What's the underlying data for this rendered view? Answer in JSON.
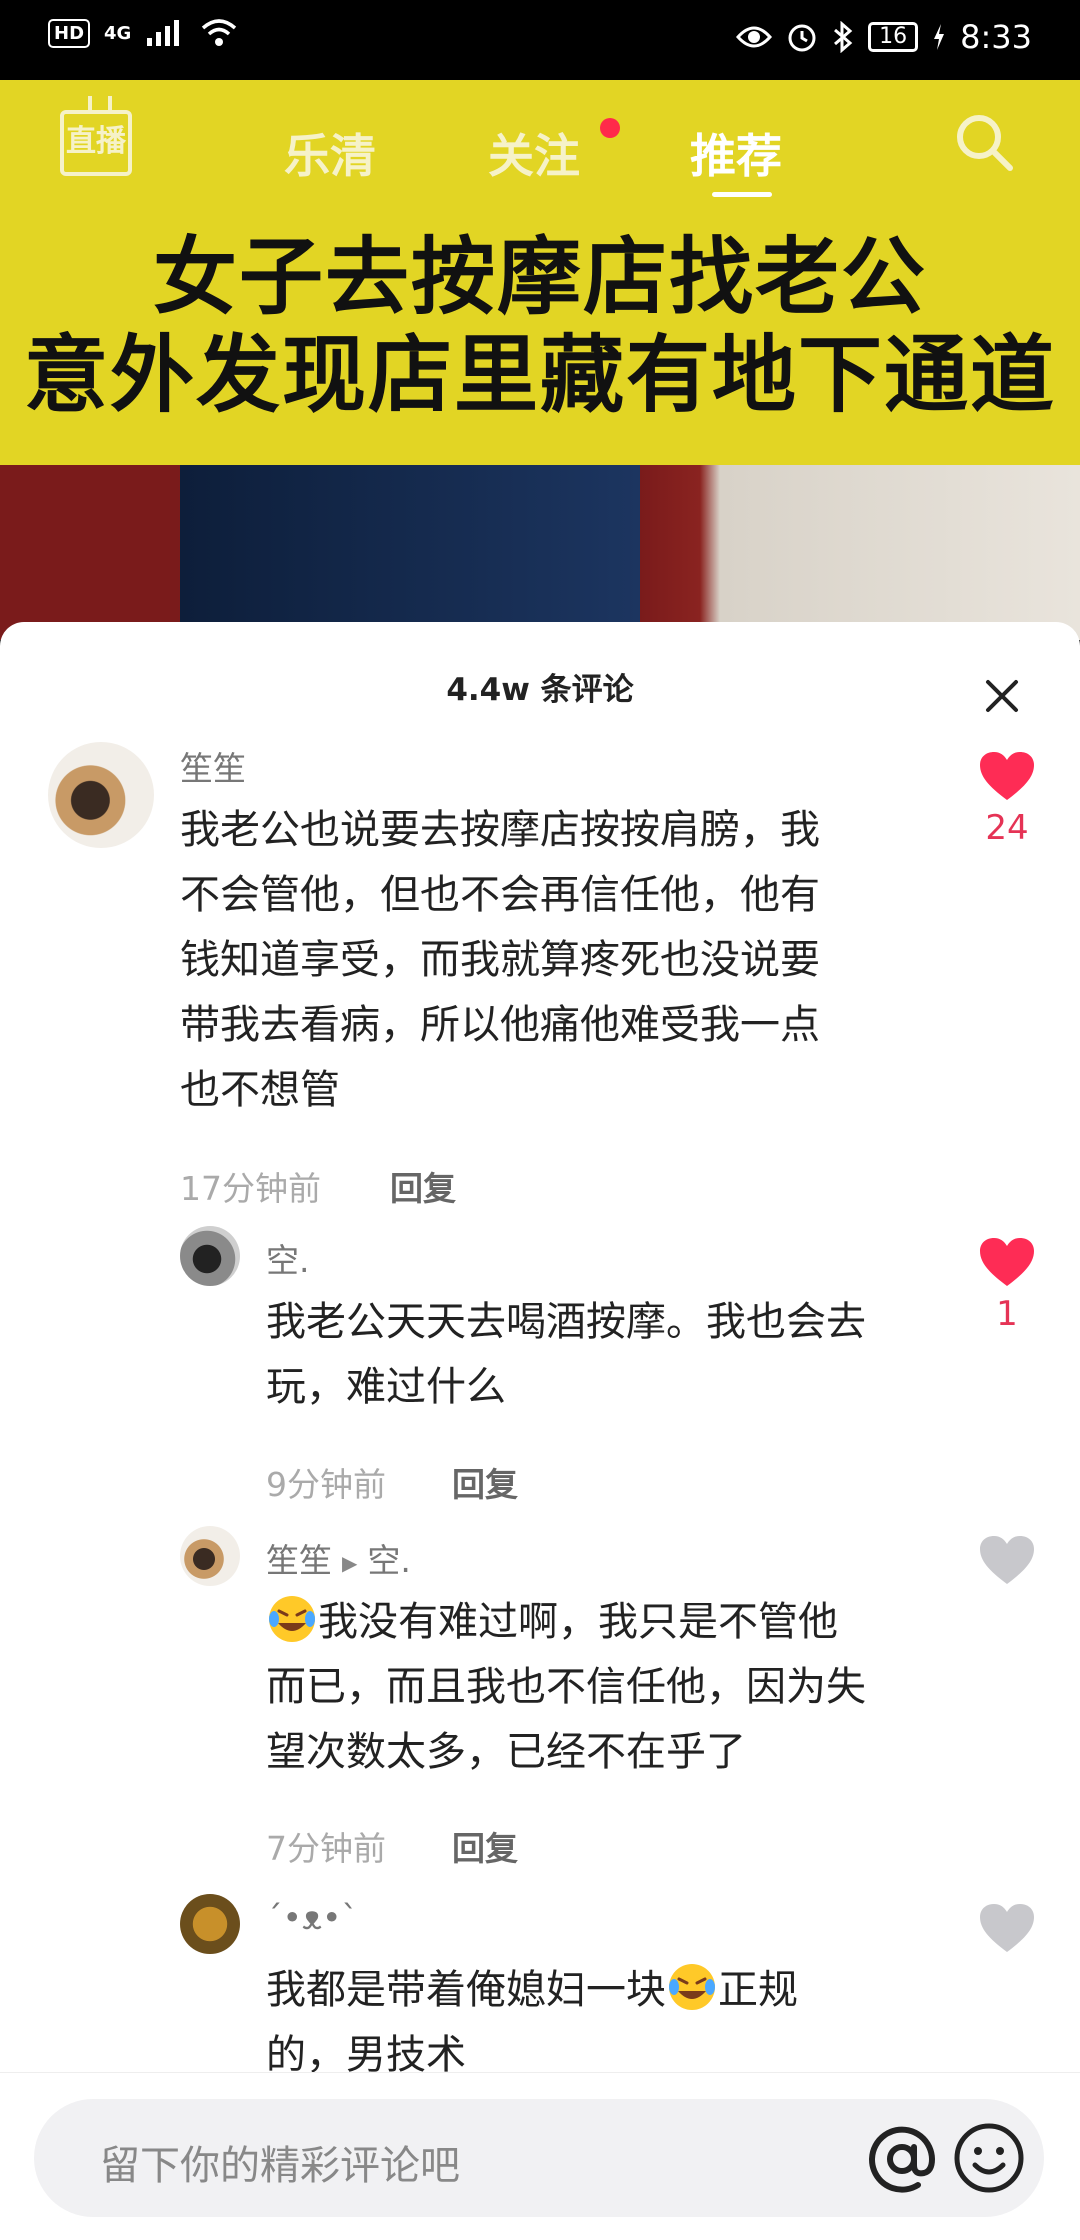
{
  "status_bar": {
    "hd": "HD",
    "network": "4G",
    "battery": "16",
    "time": "8:33"
  },
  "video": {
    "title_line1": "女子去按摩店找老公",
    "title_line2": "意外发现店里藏有地下通道",
    "banner_color": "#e2d524"
  },
  "top_nav": {
    "live_label": "直播",
    "tabs": [
      {
        "label": "乐清"
      },
      {
        "label": "关注"
      },
      {
        "label": "推荐"
      }
    ],
    "active_tab": "推荐"
  },
  "comments_sheet": {
    "title": "4.4w 条评论",
    "comments": [
      {
        "name": "笙笙",
        "lines": [
          "我老公也说要去按摩店按按肩膀，我",
          "不会管他，但也不会再信任他，他有",
          "钱知道享受，而我就算疼死也没说要",
          "带我去看病，所以他痛他难受我一点",
          "也不想管"
        ],
        "time": "17分钟前",
        "reply": "回复",
        "likes": "24",
        "liked": true
      },
      {
        "name": "空.",
        "lines": [
          "我老公天天去喝酒按摩。我也会去",
          "玩，难过什么"
        ],
        "time": "9分钟前",
        "reply": "回复",
        "likes": "1",
        "liked": true
      },
      {
        "name": "笙笙",
        "reply_to": "空.",
        "lines": [
          "我没有难过啊，我只是不管他",
          "而已，而且我也不信任他，因为失",
          "望次数太多，已经不在乎了"
        ],
        "time": "7分钟前",
        "reply": "回复",
        "liked": false
      },
      {
        "name": "´•ᴥ•`",
        "lines": [
          "我都是带着俺媳妇一块",
          "正规",
          "的，男技术"
        ],
        "liked": false
      }
    ]
  },
  "input_bar": {
    "placeholder": "留下你的精彩评论吧"
  },
  "colors": {
    "like_active": "#fe2c55",
    "like_inactive": "#c8c8cc"
  }
}
